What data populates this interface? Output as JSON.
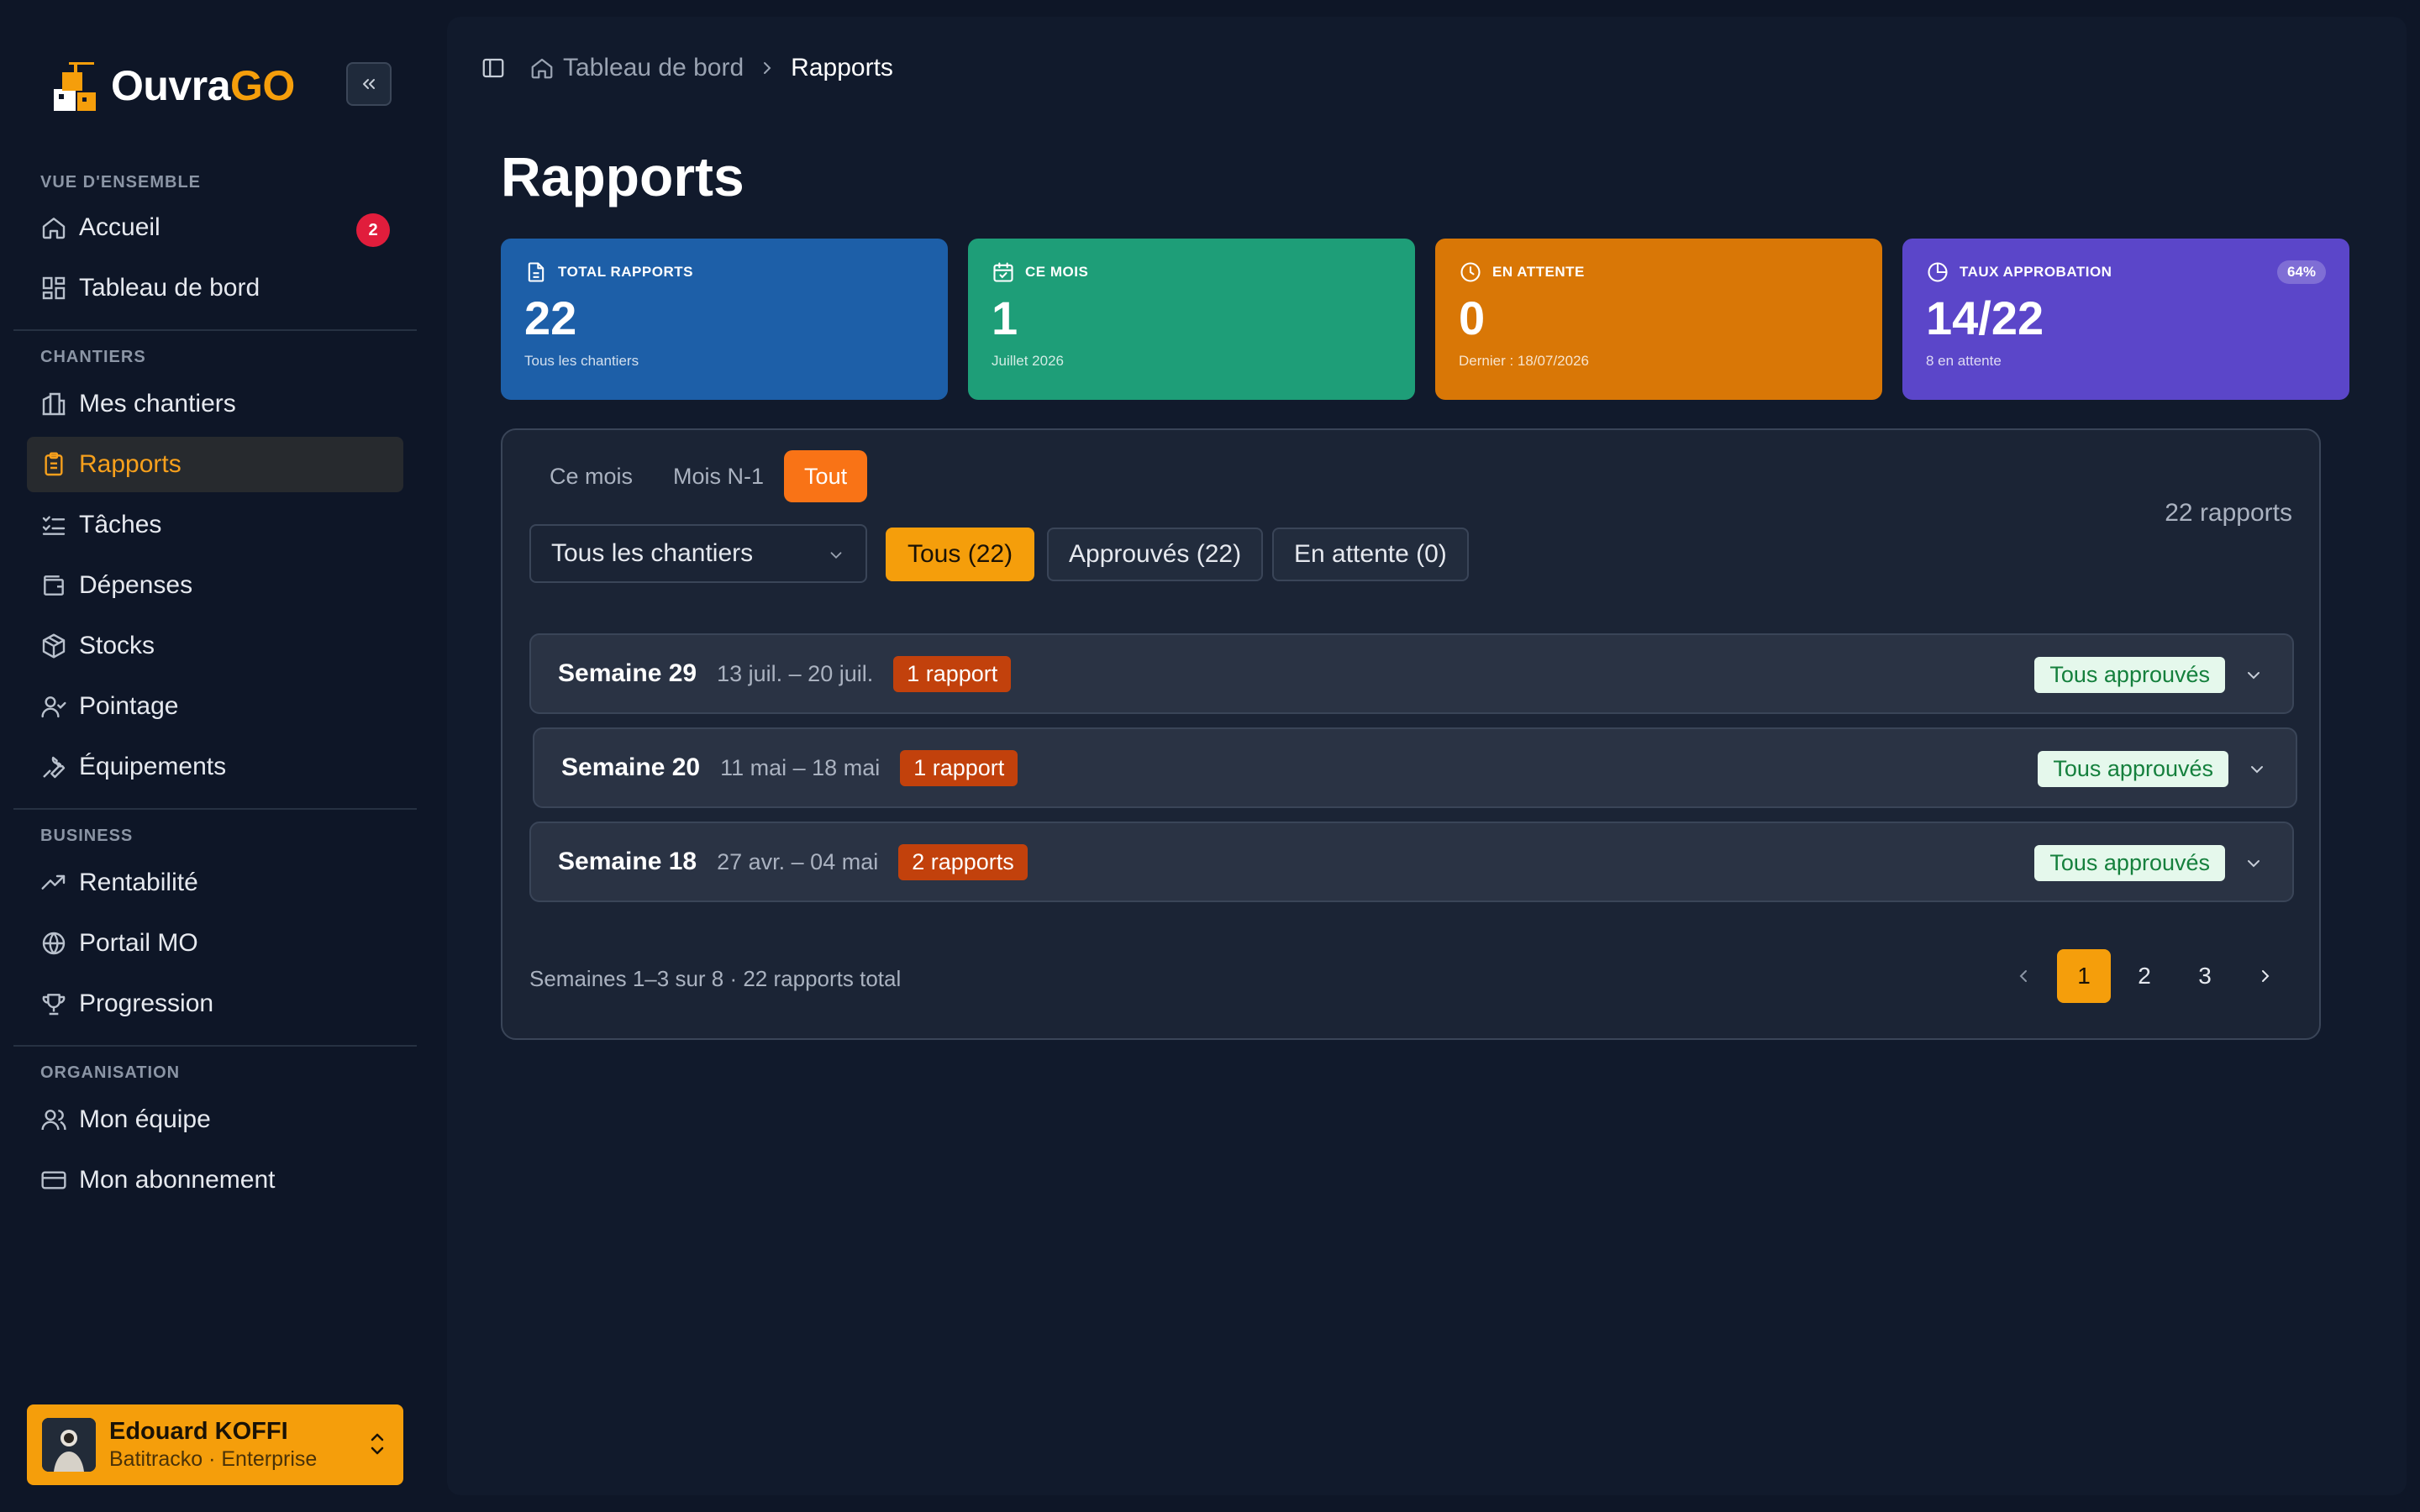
{
  "brand": {
    "name_main": "Ouvra",
    "name_accent": "GO"
  },
  "sidebar": {
    "sections": [
      {
        "label": "VUE D'ENSEMBLE"
      },
      {
        "label": "CHANTIERS"
      },
      {
        "label": "BUSINESS"
      },
      {
        "label": "ORGANISATION"
      }
    ],
    "items": [
      {
        "label": "Accueil",
        "icon": "home-icon",
        "badge": "2"
      },
      {
        "label": "Tableau de bord",
        "icon": "dashboard-icon"
      },
      {
        "label": "Mes chantiers",
        "icon": "buildings-icon"
      },
      {
        "label": "Rapports",
        "icon": "clipboard-icon",
        "active": true
      },
      {
        "label": "Tâches",
        "icon": "tasks-icon"
      },
      {
        "label": "Dépenses",
        "icon": "wallet-icon"
      },
      {
        "label": "Stocks",
        "icon": "package-icon"
      },
      {
        "label": "Pointage",
        "icon": "user-check-icon"
      },
      {
        "label": "Équipements",
        "icon": "wrench-icon"
      },
      {
        "label": "Rentabilité",
        "icon": "trending-up-icon"
      },
      {
        "label": "Portail MO",
        "icon": "globe-icon"
      },
      {
        "label": "Progression",
        "icon": "trophy-icon"
      },
      {
        "label": "Mon équipe",
        "icon": "users-icon"
      },
      {
        "label": "Mon abonnement",
        "icon": "credit-card-icon"
      }
    ],
    "user": {
      "name": "Edouard KOFFI",
      "subtitle": "Batitracko · Enterprise"
    }
  },
  "breadcrumb": {
    "home": "Tableau de bord",
    "current": "Rapports"
  },
  "page": {
    "title": "Rapports"
  },
  "stats": [
    {
      "label": "TOTAL RAPPORTS",
      "value": "22",
      "sub": "Tous les chantiers",
      "color": "#1d5fa8",
      "icon": "file-icon"
    },
    {
      "label": "CE MOIS",
      "value": "1",
      "sub": "Juillet 2026",
      "color": "#1e9e78",
      "icon": "calendar-check-icon"
    },
    {
      "label": "EN ATTENTE",
      "value": "0",
      "sub": "Dernier : 18/07/2026",
      "color": "#d97706",
      "icon": "clock-icon"
    },
    {
      "label": "TAUX APPROBATION",
      "value": "14/22",
      "sub": "8 en attente",
      "color": "#5b46c9",
      "icon": "pie-chart-icon",
      "pill": "64%"
    }
  ],
  "period_tabs": [
    "Ce mois",
    "Mois N-1",
    "Tout"
  ],
  "active_period": "Tout",
  "count_label": "22 rapports",
  "filters": {
    "site_select": "Tous les chantiers",
    "status": [
      "Tous (22)",
      "Approuvés (22)",
      "En attente (0)"
    ],
    "active_status": "Tous (22)"
  },
  "weeks": [
    {
      "title": "Semaine 29",
      "dates": "13 juil. – 20 juil.",
      "count": "1 rapport",
      "status": "Tous approuvés"
    },
    {
      "title": "Semaine 20",
      "dates": "11 mai – 18 mai",
      "count": "1 rapport",
      "status": "Tous approuvés"
    },
    {
      "title": "Semaine 18",
      "dates": "27 avr. – 04 mai",
      "count": "2 rapports",
      "status": "Tous approuvés"
    }
  ],
  "pagination": {
    "info": "Semaines 1–3 sur 8 · 22 rapports total",
    "pages": [
      "1",
      "2",
      "3"
    ],
    "current": "1"
  },
  "colors": {
    "accent": "#f59e0b",
    "tab_active": "#f97316",
    "badge_red": "#e11d3c",
    "count_badge": "#c2410c",
    "approved_bg": "#e5f8ec",
    "approved_text": "#15803d"
  }
}
